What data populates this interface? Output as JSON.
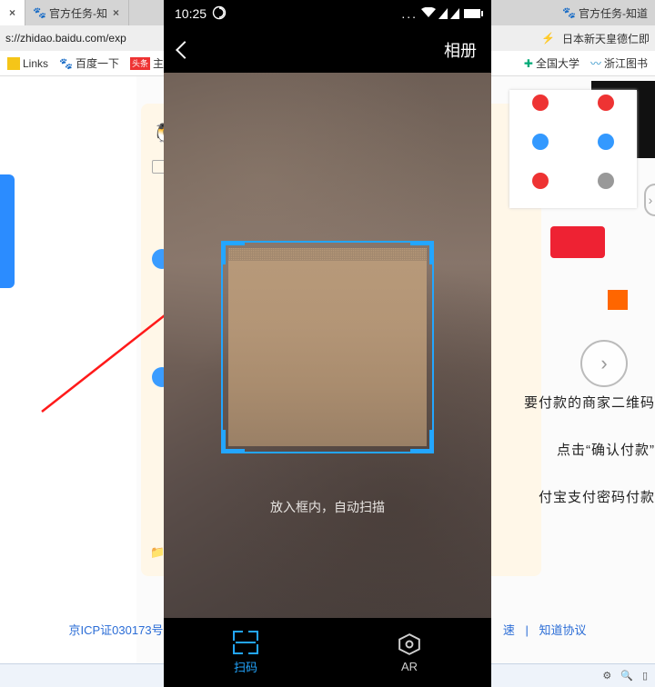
{
  "browser": {
    "tabs": [
      {
        "title": "官方任务-知",
        "close": "×"
      },
      {
        "title": "官方任务-知道"
      }
    ],
    "url": "s://zhidao.baidu.com/exp",
    "addr_right": "日本新天皇德仁即",
    "bookmarks": {
      "links": "Links",
      "baidu": "百度一下",
      "home": "主页",
      "univ": "全国大学",
      "zjlib": "浙江图书"
    }
  },
  "background": {
    "rt1": "要付款的商家二维码",
    "rt2": "点击“确认付款”",
    "rt3": "付宝支付密码付款",
    "footer": {
      "icp": "京ICP证030173号",
      "fast": "速",
      "agree": "知道协议"
    },
    "carousel_next": "›"
  },
  "phone": {
    "status": {
      "time": "10:25",
      "dots": "..."
    },
    "nav": {
      "album": "相册"
    },
    "camera": {
      "hint": "放入框内，自动扫描"
    },
    "tabs": {
      "scan": "扫码",
      "ar": "AR"
    }
  }
}
